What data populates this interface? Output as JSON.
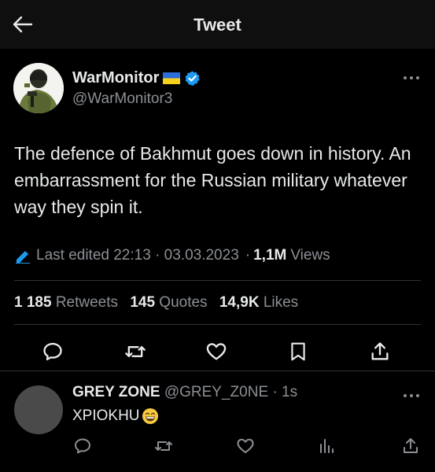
{
  "header": {
    "title": "Tweet"
  },
  "tweet": {
    "display_name": "WarMonitor",
    "handle": "@WarMonitor3",
    "text": "The defence of Bakhmut goes down in history. An embarrassment for the Russian military whatever way they spin it.",
    "edited_label": "Last edited 22:13 · 03.03.2023",
    "separator": "·",
    "views_count": "1,1M",
    "views_label": "Views",
    "retweets_count": "1 185",
    "retweets_label": "Retweets",
    "quotes_count": "145",
    "quotes_label": "Quotes",
    "likes_count": "14,9K",
    "likes_label": "Likes"
  },
  "reply": {
    "display_name": "GREY ZONE",
    "handle": "@GREY_Z0NE",
    "time": "· 1s",
    "text": "XPIOKHU"
  },
  "colors": {
    "background": "#000000",
    "text_primary": "#e7e9ea",
    "text_secondary": "#8b8f94",
    "verified": "#1d9bf0",
    "edit_icon": "#1d9bf0",
    "divider": "#2f3336"
  },
  "icons": {
    "back": "arrow-left-icon",
    "flag": "ukraine-flag-icon",
    "verified": "verified-badge-icon",
    "more": "more-horizontal-icon",
    "edit": "pencil-icon",
    "reply": "reply-icon",
    "retweet": "retweet-icon",
    "like": "heart-icon",
    "bookmark": "bookmark-icon",
    "share": "share-icon",
    "analytics": "analytics-icon",
    "emoji": "grinning-face-emoji"
  }
}
